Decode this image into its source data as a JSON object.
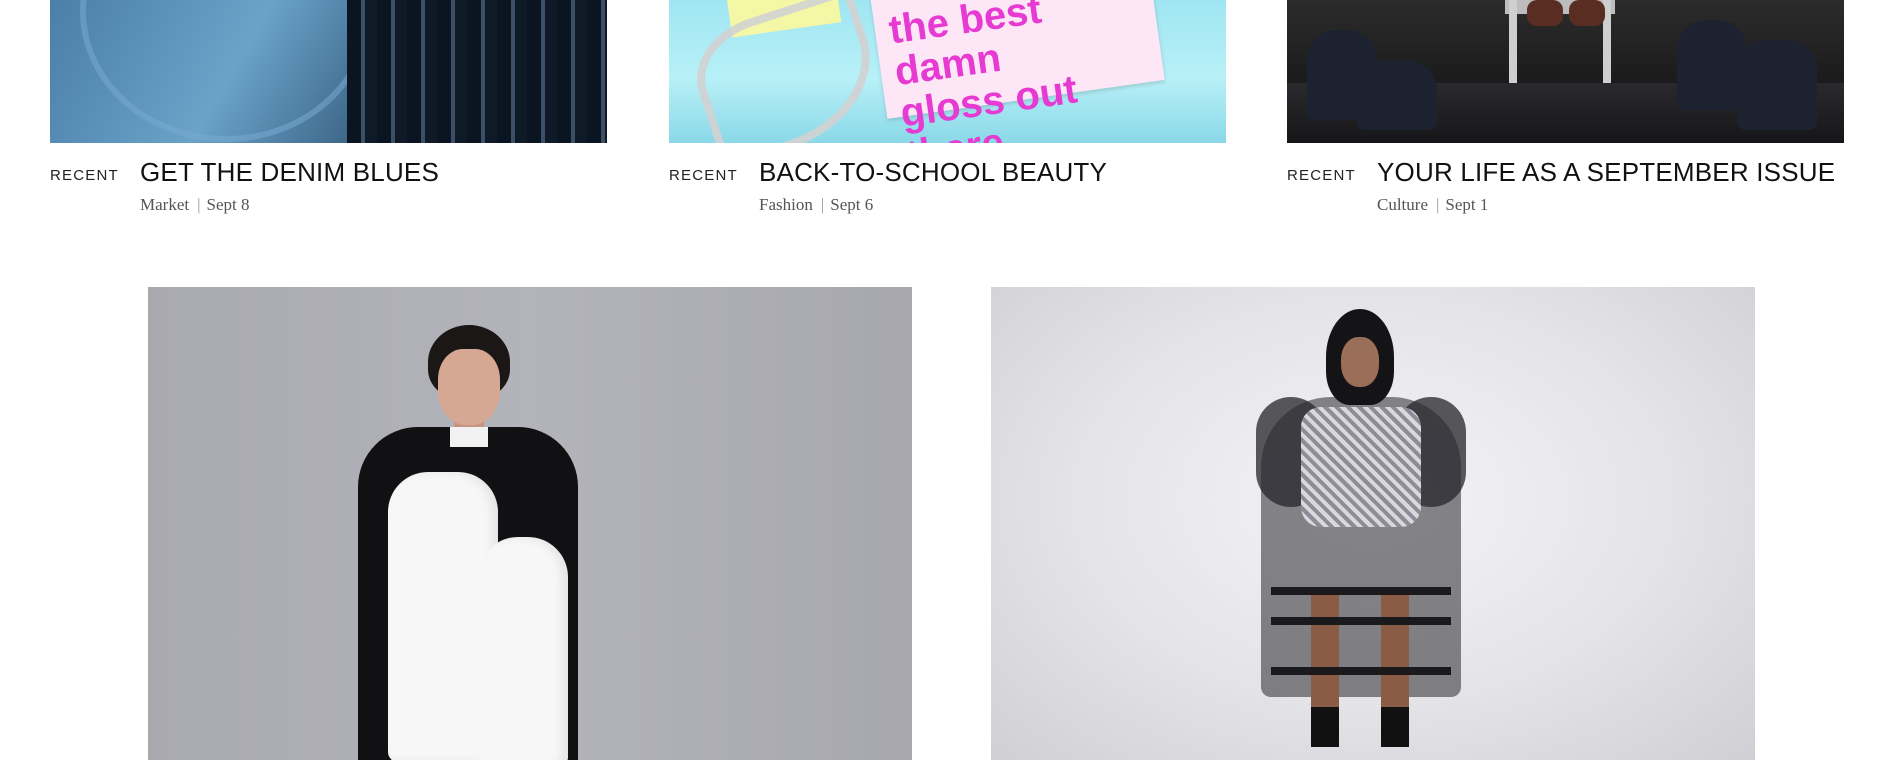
{
  "cards": [
    {
      "label": "RECENT",
      "title": "GET THE DENIM BLUES",
      "category": "Market",
      "date": "Sept 8"
    },
    {
      "label": "RECENT",
      "title": "BACK-TO-SCHOOL BEAUTY",
      "category": "Fashion",
      "date": "Sept 6",
      "image_text_line1": "the best damn",
      "image_text_line2": "gloss out there"
    },
    {
      "label": "RECENT",
      "title": "YOUR LIFE AS A SEPTEMBER ISSUE",
      "category": "Culture",
      "date": "Sept 1"
    }
  ],
  "separator": "|",
  "colors": {
    "sticker_text": "#e63ad2",
    "sticker_bg": "#fde7f6",
    "meta_text": "#555555"
  }
}
